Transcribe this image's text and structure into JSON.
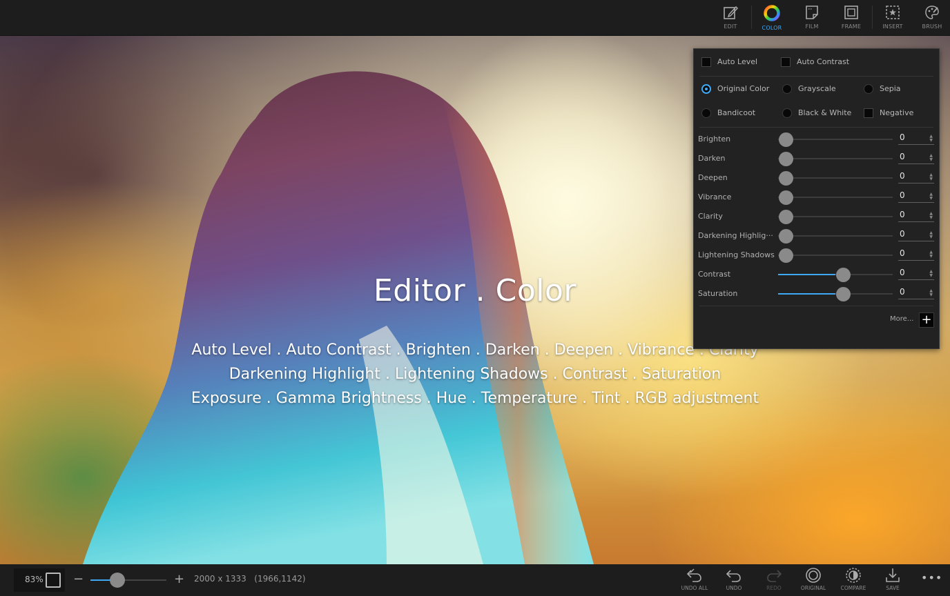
{
  "toolbar": {
    "tools": [
      {
        "label": "EDIT",
        "icon": "edit-icon"
      },
      {
        "label": "COLOR",
        "icon": "color-wheel-icon",
        "active": true
      },
      {
        "label": "FILM",
        "icon": "film-icon"
      },
      {
        "label": "FRAME",
        "icon": "frame-icon"
      },
      {
        "label": "INSERT",
        "icon": "insert-icon"
      },
      {
        "label": "BRUSH",
        "icon": "brush-icon"
      }
    ]
  },
  "overlay": {
    "title": "Editor . Color",
    "features": [
      "Auto Level . Auto Contrast . Brighten . Darken . Deepen . Vibrance . Clarity",
      "Darkening Highlight . Lightening Shadows . Contrast . Saturation",
      "Exposure . Gamma Brightness . Hue . Temperature . Tint . RGB adjustment"
    ]
  },
  "panel": {
    "auto_options": [
      {
        "label": "Auto Level",
        "checked": false
      },
      {
        "label": "Auto Contrast",
        "checked": false
      }
    ],
    "color_modes": [
      {
        "label": "Original Color",
        "type": "radio",
        "selected": true
      },
      {
        "label": "Grayscale",
        "type": "radio",
        "selected": false
      },
      {
        "label": "Sepia",
        "type": "radio",
        "selected": false
      },
      {
        "label": "Bandicoot",
        "type": "radio",
        "selected": false
      },
      {
        "label": "Black & White",
        "type": "radio",
        "selected": false
      },
      {
        "label": "Negative",
        "type": "checkbox",
        "selected": false
      }
    ],
    "sliders": [
      {
        "label": "Brighten",
        "value": "0",
        "level": 0.0
      },
      {
        "label": "Darken",
        "value": "0",
        "level": 0.0
      },
      {
        "label": "Deepen",
        "value": "0",
        "level": 0.0
      },
      {
        "label": "Vibrance",
        "value": "0",
        "level": 0.0
      },
      {
        "label": "Clarity",
        "value": "0",
        "level": 0.0
      },
      {
        "label": "Darkening Highlig···",
        "value": "0",
        "level": 0.0
      },
      {
        "label": "Lightening Shadows",
        "value": "0",
        "level": 0.0
      },
      {
        "label": "Contrast",
        "value": "0",
        "level": 0.5
      },
      {
        "label": "Saturation",
        "value": "0",
        "level": 0.5
      }
    ],
    "more_label": "More...",
    "more_button": "+"
  },
  "bottom": {
    "zoom_value": "83%",
    "zoom_level": 0.35,
    "dimensions": "2000 x 1333",
    "coordinates": "(1966,1142)",
    "tools": [
      {
        "label": "UNDO ALL",
        "icon": "undo-all-icon",
        "enabled": true
      },
      {
        "label": "UNDO",
        "icon": "undo-icon",
        "enabled": true
      },
      {
        "label": "REDO",
        "icon": "redo-icon",
        "enabled": false
      },
      {
        "label": "ORIGINAL",
        "icon": "original-icon",
        "enabled": true
      },
      {
        "label": "COMPARE",
        "icon": "compare-icon",
        "enabled": true
      },
      {
        "label": "SAVE",
        "icon": "save-icon",
        "enabled": true
      }
    ],
    "more_icon": "more-dots-icon"
  },
  "colors": {
    "accent": "#3fa9f5",
    "panel_bg": "#222222",
    "bar_bg": "#1d1d1d"
  }
}
